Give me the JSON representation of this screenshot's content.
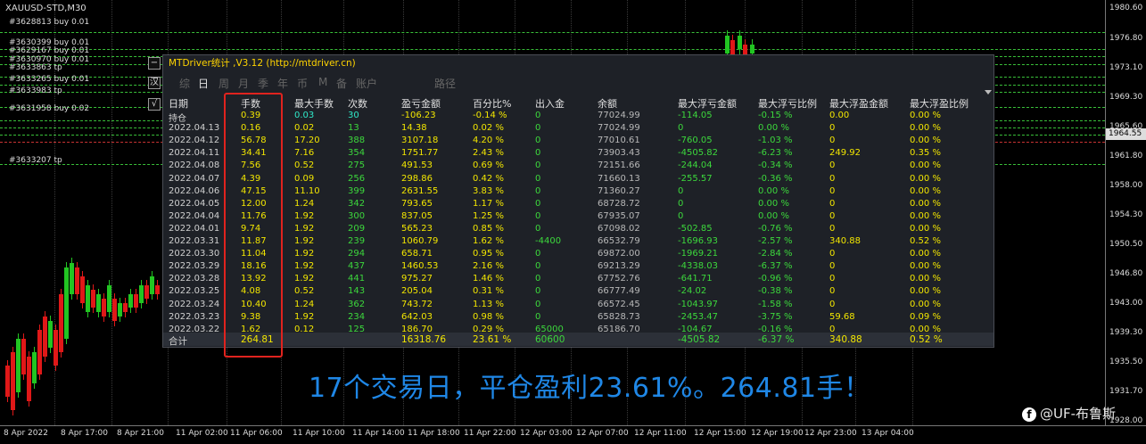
{
  "chart": {
    "symbol": "XAUUSD-STD,M30",
    "order_labels": [
      "#3628813 buy 0.01",
      "#3630399 buy 0.01",
      "#3629167 buy 0.01",
      "#3630970 buy 0.01",
      "#3633863 tp",
      "#3633265 buy 0.01",
      "#3633983 tp",
      "#3631958 buy 0.02",
      "#3633207 tp"
    ],
    "price_ticks": [
      "1980.60",
      "1976.80",
      "1973.10",
      "1969.30",
      "1965.60",
      "1961.80",
      "1958.00",
      "1954.30",
      "1950.50",
      "1946.80",
      "1943.00",
      "1939.30",
      "1935.50",
      "1931.70",
      "1928.00"
    ],
    "current_price": "1964.55",
    "time_ticks": [
      "8 Apr 2022",
      "8 Apr 17:00",
      "8 Apr 21:00",
      "11 Apr 02:00",
      "11 Apr 06:00",
      "11 Apr 10:00",
      "11 Apr 14:00",
      "11 Apr 18:00",
      "11 Apr 22:00",
      "12 Apr 03:00",
      "12 Apr 07:00",
      "12 Apr 11:00",
      "12 Apr 15:00",
      "12 Apr 19:00",
      "12 Apr 23:00",
      "13 Apr 04:00"
    ],
    "side_buttons": [
      "−",
      "汉",
      "√"
    ]
  },
  "panel": {
    "title": "MTDriver统计 ,V3.12 (http://mtdriver.cn)",
    "tabs": [
      "综",
      "日",
      "周",
      "月",
      "季",
      "年",
      "币",
      "M",
      "备",
      "账户",
      "路径"
    ],
    "active_tab": "日",
    "columns": [
      "日期",
      "手数",
      "最大手数",
      "次数",
      "盈亏金额",
      "百分比%",
      "出入金",
      "余额",
      "最大浮亏金额",
      "最大浮亏比例",
      "最大浮盈金额",
      "最大浮盈比例"
    ],
    "rows": [
      [
        "持仓",
        "0.39",
        "0.03",
        "30",
        "-106.23",
        "-0.14 %",
        "0",
        "77024.99",
        "-114.05",
        "-0.15 %",
        "0.00",
        "0.00 %"
      ],
      [
        "2022.04.13",
        "0.16",
        "0.02",
        "13",
        "14.38",
        "0.02 %",
        "0",
        "77024.99",
        "0",
        "0.00 %",
        "0",
        "0.00 %"
      ],
      [
        "2022.04.12",
        "56.78",
        "17.20",
        "388",
        "3107.18",
        "4.20 %",
        "0",
        "77010.61",
        "-760.05",
        "-1.03 %",
        "0",
        "0.00 %"
      ],
      [
        "2022.04.11",
        "34.41",
        "7.16",
        "354",
        "1751.77",
        "2.43 %",
        "0",
        "73903.43",
        "-4505.82",
        "-6.23 %",
        "249.92",
        "0.35 %"
      ],
      [
        "2022.04.08",
        "7.56",
        "0.52",
        "275",
        "491.53",
        "0.69 %",
        "0",
        "72151.66",
        "-244.04",
        "-0.34 %",
        "0",
        "0.00 %"
      ],
      [
        "2022.04.07",
        "4.39",
        "0.09",
        "256",
        "298.86",
        "0.42 %",
        "0",
        "71660.13",
        "-255.57",
        "-0.36 %",
        "0",
        "0.00 %"
      ],
      [
        "2022.04.06",
        "47.15",
        "11.10",
        "399",
        "2631.55",
        "3.83 %",
        "0",
        "71360.27",
        "0",
        "0.00 %",
        "0",
        "0.00 %"
      ],
      [
        "2022.04.05",
        "12.00",
        "1.24",
        "342",
        "793.65",
        "1.17 %",
        "0",
        "68728.72",
        "0",
        "0.00 %",
        "0",
        "0.00 %"
      ],
      [
        "2022.04.04",
        "11.76",
        "1.92",
        "300",
        "837.05",
        "1.25 %",
        "0",
        "67935.07",
        "0",
        "0.00 %",
        "0",
        "0.00 %"
      ],
      [
        "2022.04.01",
        "9.74",
        "1.92",
        "209",
        "565.23",
        "0.85 %",
        "0",
        "67098.02",
        "-502.85",
        "-0.76 %",
        "0",
        "0.00 %"
      ],
      [
        "2022.03.31",
        "11.87",
        "1.92",
        "239",
        "1060.79",
        "1.62 %",
        "-4400",
        "66532.79",
        "-1696.93",
        "-2.57 %",
        "340.88",
        "0.52 %"
      ],
      [
        "2022.03.30",
        "11.04",
        "1.92",
        "294",
        "658.71",
        "0.95 %",
        "0",
        "69872.00",
        "-1969.21",
        "-2.84 %",
        "0",
        "0.00 %"
      ],
      [
        "2022.03.29",
        "18.16",
        "1.92",
        "437",
        "1460.53",
        "2.16 %",
        "0",
        "69213.29",
        "-4338.03",
        "-6.37 %",
        "0",
        "0.00 %"
      ],
      [
        "2022.03.28",
        "13.92",
        "1.92",
        "441",
        "975.27",
        "1.46 %",
        "0",
        "67752.76",
        "-641.71",
        "-0.96 %",
        "0",
        "0.00 %"
      ],
      [
        "2022.03.25",
        "4.08",
        "0.52",
        "143",
        "205.04",
        "0.31 %",
        "0",
        "66777.49",
        "-24.02",
        "-0.38 %",
        "0",
        "0.00 %"
      ],
      [
        "2022.03.24",
        "10.40",
        "1.24",
        "362",
        "743.72",
        "1.13 %",
        "0",
        "66572.45",
        "-1043.97",
        "-1.58 %",
        "0",
        "0.00 %"
      ],
      [
        "2022.03.23",
        "9.38",
        "1.92",
        "234",
        "642.03",
        "0.98 %",
        "0",
        "65828.73",
        "-2453.47",
        "-3.75 %",
        "59.68",
        "0.09 %"
      ],
      [
        "2022.03.22",
        "1.62",
        "0.12",
        "125",
        "186.70",
        "0.29 %",
        "65000",
        "65186.70",
        "-104.67",
        "-0.16 %",
        "0",
        "0.00 %"
      ]
    ],
    "total": [
      "合计",
      "264.81",
      "",
      "",
      "16318.76",
      "23.61 %",
      "60600",
      "",
      "-4505.82",
      "-6.37 %",
      "340.88",
      "0.52 %"
    ]
  },
  "caption": "17个交易日，平仓盈利23.61%。264.81手！",
  "watermark": "@UF-布鲁斯"
}
